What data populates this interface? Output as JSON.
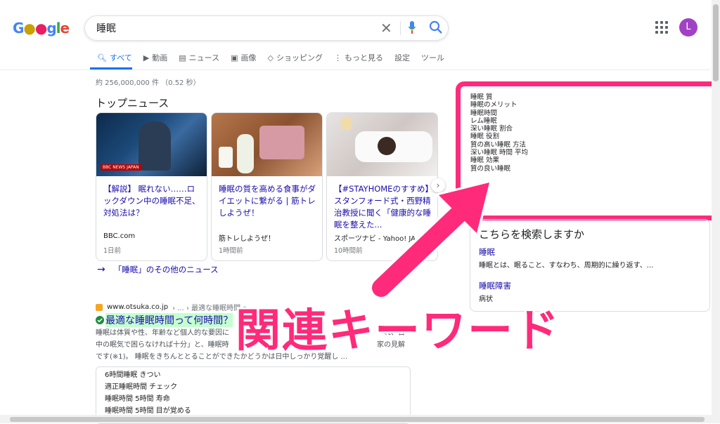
{
  "search": {
    "query": "睡眠"
  },
  "account": {
    "initial": "L"
  },
  "tabs": [
    "すべて",
    "動画",
    "ニュース",
    "画像",
    "ショッピング",
    "もっと見る",
    "設定",
    "ツール"
  ],
  "stats": "約 256,000,000 件 （0.52 秒）",
  "top_news": {
    "heading": "トップニュース",
    "image_label": "BBC NEWS JAPAN",
    "cards": [
      {
        "title": "【解説】 眠れない……ロックダウン中の睡眠不足、対処法は？",
        "source": "BBC.com",
        "time": "1日前"
      },
      {
        "title": "睡眠の質を高める食事がダイエットに繋がる | 筋トレしようぜ！",
        "source": "筋トレしようぜ！",
        "time": "1時間前"
      },
      {
        "title": "【#STAYHOMEのすすめ】スタンフォード式・西野精治教授に聞く「健康的な睡眠を整えた...",
        "source": "スポーツナビ - Yahoo! JA",
        "time": "10時間前"
      }
    ],
    "more": "「睡眠」のその他のニュース"
  },
  "result": {
    "site": "www.otsuka.co.jp",
    "breadcrumb": "› ... › 最適な睡眠時間っ",
    "title": "最適な睡眠時間って何時間？",
    "snippet": [
      "睡眠は体質や性、年齢など個人的な要因に",
      "れ、日",
      "中の眠気で困らなければ十分」と、睡眠時",
      "家の見解",
      "です(※1)。 睡眠をきちんととることができたかどうかは日中しっかり覚醒し ..."
    ]
  },
  "related_searches": [
    "6時間睡眠 きつい",
    "適正睡眠時間 チェック",
    "睡眠時間 5時間 寿命",
    "睡眠時間 5時間 目が覚める"
  ],
  "keywords": [
    "睡眠 質",
    "睡眠のメリット",
    "睡眠時間",
    "レム睡眠",
    "深い睡眠 割合",
    "睡眠 役割",
    "質の高い睡眠 方法",
    "深い睡眠 時間 平均",
    "睡眠 効果",
    "質の良い睡眠"
  ],
  "did_you_mean": {
    "heading": "こちらを検索しますか",
    "items": [
      {
        "link": "睡眠",
        "desc": "睡眠とは、眠ること、すなわち、周期的に繰り返す、..."
      },
      {
        "link": "睡眠障害",
        "desc": "病状"
      }
    ]
  },
  "annotation": "関連キーワード",
  "colors": {
    "accent": "#ff2a7a",
    "link": "#1a0dab",
    "tab_active": "#1a73e8"
  }
}
